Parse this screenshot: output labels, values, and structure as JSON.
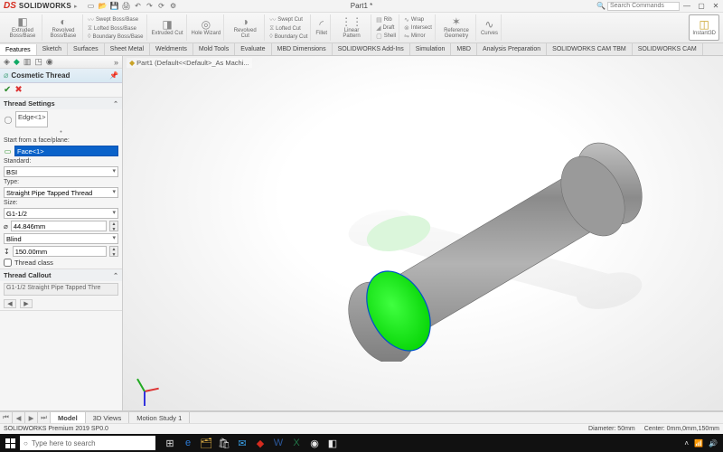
{
  "app": {
    "brand_symbol": "DS",
    "brand_name": "SOLIDWORKS",
    "document_title": "Part1 *",
    "search_placeholder": "Search Commands"
  },
  "ribbon": {
    "groups": [
      {
        "label": "Extruded Boss/Base"
      },
      {
        "label": "Revolved Boss/Base"
      }
    ],
    "stack_a": [
      "Swept Boss/Base",
      "Lofted Boss/Base",
      "Boundary Boss/Base"
    ],
    "groups2": [
      {
        "label": "Extruded Cut"
      },
      {
        "label": "Hole Wizard"
      },
      {
        "label": "Revolved Cut"
      }
    ],
    "stack_b": [
      "Swept Cut",
      "Lofted Cut",
      "Boundary Cut"
    ],
    "groups3": [
      {
        "label": "Fillet"
      },
      {
        "label": "Linear Pattern"
      }
    ],
    "stack_c": [
      "Rib",
      "Draft",
      "Shell"
    ],
    "stack_d": [
      "Wrap",
      "Intersect",
      "Mirror"
    ],
    "groups4": [
      {
        "label": "Reference Geometry"
      },
      {
        "label": "Curves"
      }
    ],
    "instant3d_label": "Instant3D"
  },
  "cm_tabs": [
    "Features",
    "Sketch",
    "Surfaces",
    "Sheet Metal",
    "Weldments",
    "Mold Tools",
    "Evaluate",
    "MBD Dimensions",
    "SOLIDWORKS Add-Ins",
    "Simulation",
    "MBD",
    "Analysis Preparation",
    "SOLIDWORKS CAM TBM",
    "SOLIDWORKS CAM"
  ],
  "pm": {
    "title": "Cosmetic Thread",
    "thread_settings_hdr": "Thread Settings",
    "edge_value": "Edge<1>",
    "start_label": "Start from a face/plane:",
    "face_selected": "Face<1>",
    "standard_label": "Standard:",
    "standard_value": "BSI",
    "type_label": "Type:",
    "type_value": "Straight Pipe Tapped Thread",
    "size_label": "Size:",
    "size_value": "G1-1/2",
    "diameter_value": "44.846mm",
    "end_value": "Blind",
    "depth_value": "150.00mm",
    "thread_class_label": "Thread class",
    "callout_hdr": "Thread Callout",
    "callout_text": "G1-1/2 Straight Pipe Tapped Thre"
  },
  "doc_crumb": "Part1 (Default<<Default>_As Machi...",
  "bottom_tabs": [
    "Model",
    "3D Views",
    "Motion Study 1"
  ],
  "status": {
    "left": "SOLIDWORKS Premium 2019 SP0.0",
    "right_a": "Diameter: 50mm",
    "right_b": "Center: 0mm,0mm,150mm"
  },
  "taskbar": {
    "search_placeholder": "Type here to search"
  }
}
